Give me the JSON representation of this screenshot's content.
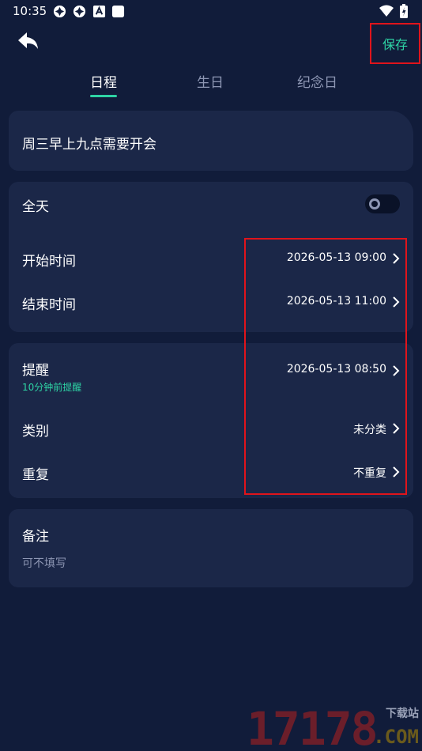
{
  "status_bar": {
    "time": "10:35",
    "icons": [
      "app-circle-icon",
      "app-circle-icon",
      "font-box-icon",
      "square-icon",
      "wifi-icon",
      "battery-icon"
    ]
  },
  "header": {
    "back_icon": "back-arrow-icon",
    "save_label": "保存"
  },
  "tabs": [
    {
      "label": "日程",
      "active": true
    },
    {
      "label": "生日",
      "active": false
    },
    {
      "label": "纪念日",
      "active": false
    }
  ],
  "event": {
    "title": "周三早上九点需要开会"
  },
  "time_section": {
    "all_day_label": "全天",
    "all_day_on": false,
    "start_label": "开始时间",
    "start_value": "2026-05-13 09:00",
    "end_label": "结束时间",
    "end_value": "2026-05-13 11:00"
  },
  "remind_section": {
    "remind_label": "提醒",
    "remind_sub": "10分钟前提醒",
    "remind_value": "2026-05-13 08:50",
    "category_label": "类别",
    "category_value": "未分类",
    "repeat_label": "重复",
    "repeat_value": "不重复"
  },
  "note_section": {
    "label": "备注",
    "placeholder": "可不填写"
  },
  "watermark": {
    "number": "17178",
    "suffix": "下载站",
    "domain": ".COM"
  },
  "colors": {
    "background": "#111c3a",
    "card": "#1b2748",
    "accent": "#2ed3a4",
    "highlight": "#e0141b"
  }
}
